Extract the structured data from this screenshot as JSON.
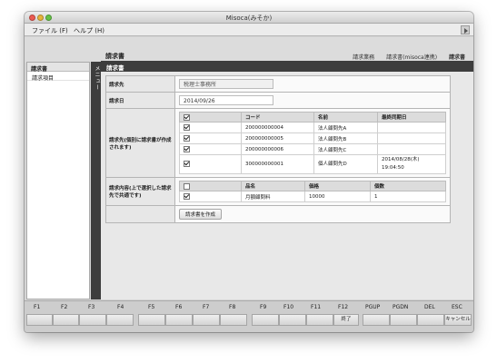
{
  "window": {
    "title": "Misoca(みそか)"
  },
  "menubar": {
    "file": "ファイル (F)",
    "help": "ヘルプ (H)"
  },
  "header": {
    "page_title": "請求書",
    "breadcrumbs": [
      "請求業務",
      "請求書(misoca連携)",
      "請求書"
    ]
  },
  "sidebar": {
    "heading": "請求書",
    "items": [
      "請求項目"
    ]
  },
  "menu_tab": "メニュー",
  "section": {
    "title": "請求書"
  },
  "form": {
    "client_label": "請求先",
    "client_value": "税理士事務所",
    "date_label": "請求日",
    "date_value": "2014/09/26",
    "customers_label": "請求先(個別に請求書が作成されます)",
    "customers_columns": [
      "コード",
      "名前",
      "最終同期日"
    ],
    "customers": [
      {
        "code": "200000000004",
        "name": "法人顧問先A",
        "synced": ""
      },
      {
        "code": "200000000005",
        "name": "法人顧問先B",
        "synced": ""
      },
      {
        "code": "200000000006",
        "name": "法人顧問先C",
        "synced": ""
      },
      {
        "code": "300000000001",
        "name": "個人顧問先D",
        "synced_date": "2014/08/28(木)",
        "synced_time": "19:04:50"
      }
    ],
    "items_label": "請求内容(上で選択した請求先で共通です)",
    "items_columns": [
      "品名",
      "価格",
      "個数"
    ],
    "items": [
      {
        "name": "月額顧問料",
        "price": "10000",
        "qty": "1"
      }
    ],
    "create_button": "請求書を作成"
  },
  "fkeys": [
    "F1",
    "F2",
    "F3",
    "F4",
    "F5",
    "F6",
    "F7",
    "F8",
    "F9",
    "F10",
    "F11",
    "F12",
    "PGUP",
    "PGDN",
    "DEL",
    "ESC"
  ],
  "fbuttons": {
    "f12": "終了",
    "esc": "キャンセル"
  }
}
